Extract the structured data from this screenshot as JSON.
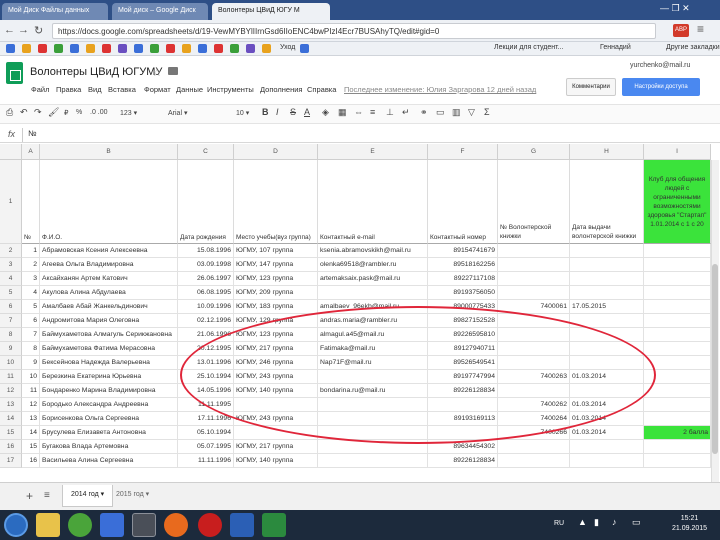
{
  "browser": {
    "tabs": [
      "Мой Диск Файлы данных",
      "Мой диск – Google Диск",
      "Волонтеры ЦВиД ЮГУ М"
    ],
    "window_controls": "— ❐ ✕",
    "url": "https://docs.google.com/spreadsheets/d/19-VewMYBYlIIrnGsd6IIoENC4bwPIzI4Ecr7BUSAhyTQ/edit#gid=0",
    "bookmarks": [
      "Уход",
      "Лекции для студент...",
      "Геннадий",
      "Другие закладки"
    ],
    "extension_label": "ABP",
    "colors": {
      "tabbar": "#2e4f86",
      "accent_blue": "#4a88f0",
      "sheets_green": "#0f9d58",
      "highlight_green": "#3be33b",
      "annotation_red": "#e0263a"
    }
  },
  "doc": {
    "title": "Волонтеры ЦВиД ЮГУМУ",
    "user": "yurchenko@mail.ru",
    "comments_label": "Комментарии",
    "share_label": "Настройки доступа",
    "menu": [
      "Файл",
      "Правка",
      "Вид",
      "Вставка",
      "Формат",
      "Данные",
      "Инструменты",
      "Дополнения",
      "Справка"
    ],
    "last_edit": "Последнее изменение: Юлия Заргарова 12 дней назад",
    "toolbar": {
      "zoom": "100%",
      "currency": "₽",
      "percent": "%",
      "decimals": ".0 .00",
      "format": "123 ▾",
      "font": "Arial ▾",
      "size": "10 ▾",
      "bold": "B",
      "italic": "I",
      "strike": "S",
      "textcolor": "A"
    },
    "formula_label": "fx",
    "formula_value": "№"
  },
  "grid": {
    "col_letters": [
      "A",
      "B",
      "C",
      "D",
      "E",
      "F",
      "G",
      "H",
      "I"
    ],
    "headers": [
      "№",
      "Ф.И.О.",
      "Дата рождения",
      "Место учебы(вуз группа)",
      "Контактный e-mail",
      "Контактный номер",
      "№ Волонтерской книжки",
      "Дата выдачи волонтерской книжки",
      "Клуб для общения людей с ограниченными возможностями здоровья \"Стартап\" 1.01.2014 с 1 с 20"
    ],
    "rows": [
      {
        "n": "2",
        "num": "1",
        "fio": "Абрамовская Ксения Алексеевна",
        "dob": "15.08.1996",
        "uni": "ЮГМУ, 107 группа",
        "email": "ksenia.abramovskikh@mail.ru",
        "phone": "89154741679",
        "book": "",
        "date": "",
        "club": ""
      },
      {
        "n": "3",
        "num": "2",
        "fio": "Агеева Ольга Владимировна",
        "dob": "03.09.1998",
        "uni": "ЮГМУ, 147 группа",
        "email": "olenka69518@rambler.ru",
        "phone": "89518162256",
        "book": "",
        "date": "",
        "club": ""
      },
      {
        "n": "4",
        "num": "3",
        "fio": "Аксайханян Артем Катович",
        "dob": "26.06.1997",
        "uni": "ЮГМУ, 123 группа",
        "email": "artemaksaix.pask@mail.ru",
        "phone": "89227117108",
        "book": "",
        "date": "",
        "club": ""
      },
      {
        "n": "5",
        "num": "4",
        "fio": "Акулова Алина Абдулаева",
        "dob": "06.08.1995",
        "uni": "ЮГМУ, 209 группа",
        "email": "",
        "phone": "89193756050",
        "book": "",
        "date": "",
        "club": ""
      },
      {
        "n": "6",
        "num": "5",
        "fio": "Амалбаев Абай Жанкельдинович",
        "dob": "10.09.1996",
        "uni": "ЮГМУ, 183 группа",
        "email": "amalbaev_96ekb@mail.ru",
        "phone": "89000775433",
        "book": "7400061",
        "date": "17.05.2015",
        "club": ""
      },
      {
        "n": "7",
        "num": "6",
        "fio": "Андромитова Мария Олеговна",
        "dob": "02.12.1996",
        "uni": "ЮГМУ, 129 группа",
        "email": "andras.maria@rambler.ru",
        "phone": "89827152528",
        "book": "",
        "date": "",
        "club": ""
      },
      {
        "n": "8",
        "num": "7",
        "fio": "Баймухаметова Алмагуль Серикжановна",
        "dob": "21.06.1996",
        "uni": "ЮГМУ, 123 группа",
        "email": "almagul.a45@mail.ru",
        "phone": "89226595810",
        "book": "",
        "date": "",
        "club": ""
      },
      {
        "n": "9",
        "num": "8",
        "fio": "Баймухаметова Фатима Мерасовна",
        "dob": "20.12.1995",
        "uni": "ЮГМУ, 217 группа",
        "email": "Fatimaka@mail.ru",
        "phone": "89127940711",
        "book": "",
        "date": "",
        "club": ""
      },
      {
        "n": "10",
        "num": "9",
        "fio": "Бексейнова Надежда Валерьевна",
        "dob": "13.01.1996",
        "uni": "ЮГМУ, 246 группа",
        "email": "Nap71F@mail.ru",
        "phone": "89526549541",
        "book": "",
        "date": "",
        "club": ""
      },
      {
        "n": "11",
        "num": "10",
        "fio": "Березкина Екатерина Юрьевна",
        "dob": "25.10.1994",
        "uni": "ЮГМУ, 243 группа",
        "email": "",
        "phone": "89197747994",
        "book": "7400263",
        "date": "01.03.2014",
        "club": ""
      },
      {
        "n": "12",
        "num": "11",
        "fio": "Бондаренко Марина Владимировна",
        "dob": "14.05.1996",
        "uni": "ЮГМУ, 140 группа",
        "email": "bondarina.ru@mail.ru",
        "phone": "89226128834",
        "book": "",
        "date": "",
        "club": ""
      },
      {
        "n": "13",
        "num": "12",
        "fio": "Бородько Александра Андреевна",
        "dob": "11.11.1995",
        "uni": "",
        "email": "",
        "phone": "",
        "book": "7400262",
        "date": "01.03.2014",
        "club": ""
      },
      {
        "n": "14",
        "num": "13",
        "fio": "Борисенкова Ольга Сергеевна",
        "dob": "17.11.1996",
        "uni": "ЮГМУ, 243 группа",
        "email": "",
        "phone": "89193169113",
        "book": "7400264",
        "date": "01.03.2014",
        "club": ""
      },
      {
        "n": "15",
        "num": "14",
        "fio": "Брусулева Елизавета Антоновна",
        "dob": "05.10.1994",
        "uni": "",
        "email": "",
        "phone": "",
        "book": "7400266",
        "date": "01.03.2014",
        "club": "2 балла"
      },
      {
        "n": "16",
        "num": "15",
        "fio": "Бугакова Влада Артемовна",
        "dob": "05.07.1995",
        "uni": "ЮГМУ, 217 группа",
        "email": "",
        "phone": "89634454302",
        "book": "",
        "date": "",
        "club": ""
      },
      {
        "n": "17",
        "num": "16",
        "fio": "Васильева Алина Сергеевна",
        "dob": "11.11.1996",
        "uni": "ЮГМУ, 140 группа",
        "email": "",
        "phone": "89226128834",
        "book": "",
        "date": "",
        "club": ""
      }
    ]
  },
  "sheets": {
    "tabs": [
      "2014 год ▾",
      "2015 год ▾"
    ]
  },
  "taskbar": {
    "lang": "RU",
    "time": "15:21",
    "date": "21.09.2015"
  }
}
